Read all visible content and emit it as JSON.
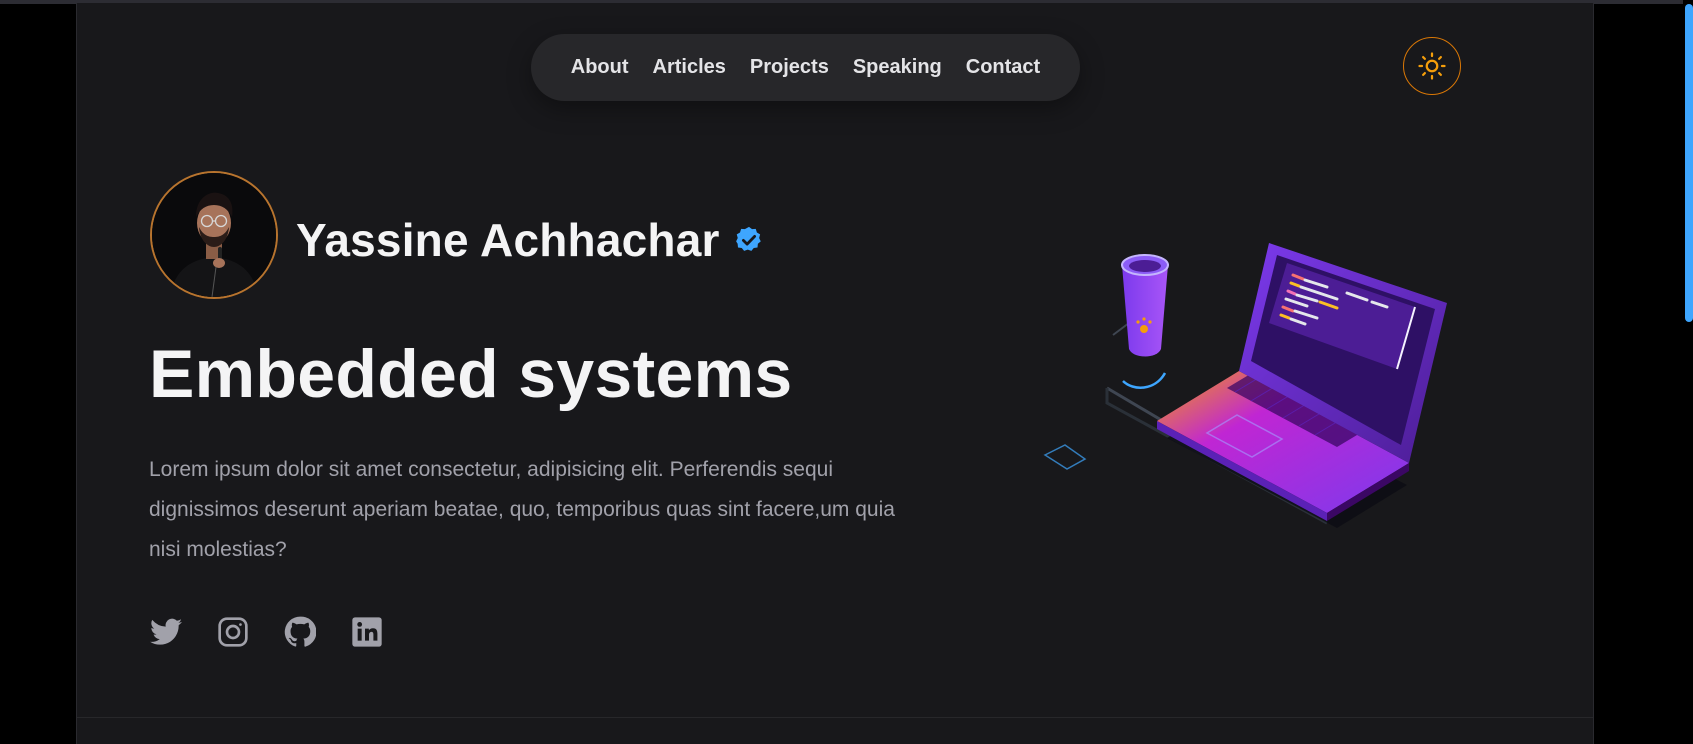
{
  "nav": {
    "items": [
      {
        "label": "About"
      },
      {
        "label": "Articles"
      },
      {
        "label": "Projects"
      },
      {
        "label": "Speaking"
      },
      {
        "label": "Contact"
      }
    ]
  },
  "theme_toggle": {
    "icon": "sun-icon",
    "accent": "#f59e0b"
  },
  "hero": {
    "name": "Yassine Achhachar",
    "verified_icon": "verified-badge-icon",
    "verified_color": "#3ea6ff",
    "headline": "Embedded systems",
    "description": "Lorem ipsum dolor sit amet consectetur, adipisicing elit. Perferendis sequi dignissimos deserunt aperiam beatae, quo, temporibus quas sint facere,um quia nisi molestias?"
  },
  "socials": [
    {
      "icon": "twitter-icon"
    },
    {
      "icon": "instagram-icon"
    },
    {
      "icon": "github-icon"
    },
    {
      "icon": "linkedin-icon"
    }
  ],
  "colors": {
    "background": "#18181b",
    "nav_background": "#27272a",
    "accent": "#d97706",
    "text": "#f4f4f5",
    "muted_text": "#a1a1aa"
  }
}
